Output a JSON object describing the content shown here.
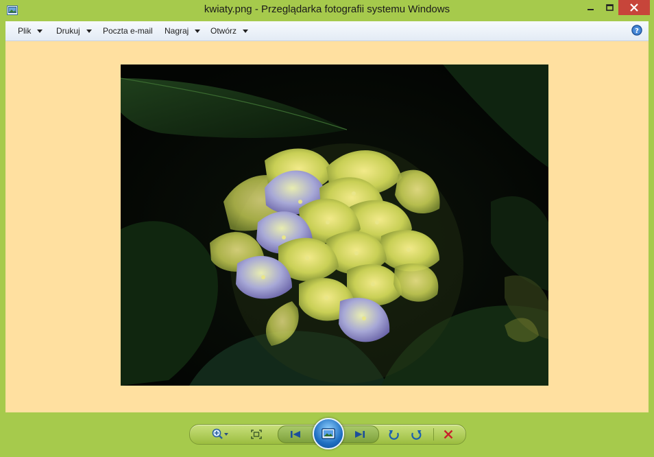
{
  "window": {
    "title": "kwiaty.png - Przeglądarka fotografii systemu Windows",
    "close_color": "#c7453a",
    "frame_color": "#a6ca4c"
  },
  "menubar": {
    "items": [
      {
        "label": "Plik",
        "has_dropdown": true
      },
      {
        "label": "Drukuj",
        "has_dropdown": true
      },
      {
        "label": "Poczta e-mail",
        "has_dropdown": false
      },
      {
        "label": "Nagraj",
        "has_dropdown": true
      },
      {
        "label": "Otwórz",
        "has_dropdown": true
      }
    ],
    "help_icon": "help-icon"
  },
  "viewer": {
    "background_color": "#ffe0a0",
    "image": "hydrangea-flower-photo"
  },
  "toolbar": {
    "icons": [
      "zoom-icon",
      "fit-to-window-icon",
      "previous-icon",
      "slideshow-icon",
      "next-icon",
      "rotate-counterclockwise-icon",
      "rotate-clockwise-icon",
      "delete-icon"
    ]
  }
}
